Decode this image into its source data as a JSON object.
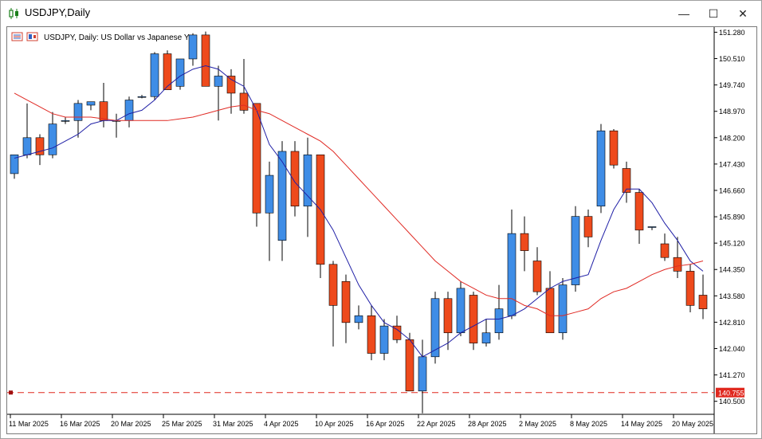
{
  "window": {
    "title": "USDJPY,Daily",
    "minimize_glyph": "—",
    "maximize_glyph": "☐",
    "close_glyph": "✕"
  },
  "chart_data": {
    "type": "candlestick",
    "title": "USDJPY, Daily:  US Dollar vs Japanese Yen",
    "symbol": "USDJPY",
    "timeframe": "Daily",
    "ylim": [
      140.12,
      151.43
    ],
    "y_ticks": [
      "151.280",
      "150.510",
      "149.740",
      "148.970",
      "148.200",
      "147.430",
      "146.660",
      "145.890",
      "145.120",
      "144.350",
      "143.580",
      "142.810",
      "142.040",
      "141.270",
      "140.500"
    ],
    "x_ticks": [
      {
        "label": "11 Mar 2025",
        "index": 0
      },
      {
        "label": "16 Mar 2025",
        "index": 4
      },
      {
        "label": "20 Mar 2025",
        "index": 8
      },
      {
        "label": "25 Mar 2025",
        "index": 12
      },
      {
        "label": "31 Mar 2025",
        "index": 16
      },
      {
        "label": "4 Apr 2025",
        "index": 20
      },
      {
        "label": "10 Apr 2025",
        "index": 24
      },
      {
        "label": "16 Apr 2025",
        "index": 28
      },
      {
        "label": "22 Apr 2025",
        "index": 32
      },
      {
        "label": "28 Apr 2025",
        "index": 36
      },
      {
        "label": "2 May 2025",
        "index": 40
      },
      {
        "label": "8 May 2025",
        "index": 44
      },
      {
        "label": "14 May 2025",
        "index": 48
      },
      {
        "label": "20 May 2025",
        "index": 52
      }
    ],
    "horizontal_line": {
      "value": 140.755,
      "label": "140.755",
      "color": "#e0281e",
      "style": "dashed"
    },
    "colors": {
      "bull": "#3f8de6",
      "bear": "#ee4a1c",
      "ma_fast": "#1f1fa6",
      "ma_slow": "#e02a24",
      "grid": "none"
    },
    "grid": false,
    "candles": [
      {
        "o": 147.15,
        "h": 147.7,
        "l": 147.0,
        "c": 147.7
      },
      {
        "o": 147.7,
        "h": 149.2,
        "l": 147.6,
        "c": 148.2
      },
      {
        "o": 148.2,
        "h": 148.3,
        "l": 147.4,
        "c": 147.7
      },
      {
        "o": 147.7,
        "h": 148.95,
        "l": 147.6,
        "c": 148.6
      },
      {
        "o": 148.7,
        "h": 148.8,
        "l": 148.6,
        "c": 148.7
      },
      {
        "o": 148.7,
        "h": 149.3,
        "l": 148.2,
        "c": 149.2
      },
      {
        "o": 149.15,
        "h": 149.25,
        "l": 149.0,
        "c": 149.25
      },
      {
        "o": 149.25,
        "h": 149.8,
        "l": 148.5,
        "c": 148.7
      },
      {
        "o": 148.7,
        "h": 148.9,
        "l": 148.2,
        "c": 148.7
      },
      {
        "o": 148.7,
        "h": 149.4,
        "l": 148.5,
        "c": 149.3
      },
      {
        "o": 149.4,
        "h": 149.45,
        "l": 149.35,
        "c": 149.4
      },
      {
        "o": 149.4,
        "h": 150.7,
        "l": 149.3,
        "c": 150.65
      },
      {
        "o": 150.65,
        "h": 150.75,
        "l": 149.6,
        "c": 149.6
      },
      {
        "o": 149.7,
        "h": 150.5,
        "l": 149.6,
        "c": 150.5
      },
      {
        "o": 150.5,
        "h": 151.25,
        "l": 150.3,
        "c": 151.2
      },
      {
        "o": 151.2,
        "h": 151.3,
        "l": 149.7,
        "c": 149.7
      },
      {
        "o": 149.7,
        "h": 150.3,
        "l": 148.7,
        "c": 150.0
      },
      {
        "o": 150.0,
        "h": 150.2,
        "l": 148.9,
        "c": 149.5
      },
      {
        "o": 149.5,
        "h": 150.5,
        "l": 148.9,
        "c": 149.0
      },
      {
        "o": 149.2,
        "h": 149.2,
        "l": 145.6,
        "c": 146.0
      },
      {
        "o": 146.0,
        "h": 147.5,
        "l": 144.6,
        "c": 147.1
      },
      {
        "o": 145.2,
        "h": 148.1,
        "l": 144.6,
        "c": 147.8
      },
      {
        "o": 147.8,
        "h": 148.1,
        "l": 145.9,
        "c": 146.2
      },
      {
        "o": 146.2,
        "h": 148.2,
        "l": 145.3,
        "c": 147.7
      },
      {
        "o": 147.7,
        "h": 147.7,
        "l": 144.1,
        "c": 144.5
      },
      {
        "o": 144.5,
        "h": 144.6,
        "l": 142.1,
        "c": 143.3
      },
      {
        "o": 144.0,
        "h": 144.2,
        "l": 142.2,
        "c": 142.8
      },
      {
        "o": 142.8,
        "h": 143.3,
        "l": 142.6,
        "c": 143.0
      },
      {
        "o": 143.0,
        "h": 143.3,
        "l": 141.7,
        "c": 141.9
      },
      {
        "o": 141.9,
        "h": 142.9,
        "l": 141.7,
        "c": 142.7
      },
      {
        "o": 142.7,
        "h": 143.0,
        "l": 142.2,
        "c": 142.3
      },
      {
        "o": 142.3,
        "h": 142.5,
        "l": 140.8,
        "c": 140.8
      },
      {
        "o": 140.8,
        "h": 142.3,
        "l": 140.15,
        "c": 141.8
      },
      {
        "o": 141.8,
        "h": 143.7,
        "l": 141.6,
        "c": 143.5
      },
      {
        "o": 143.5,
        "h": 143.7,
        "l": 142.0,
        "c": 142.5
      },
      {
        "o": 142.5,
        "h": 144.0,
        "l": 142.4,
        "c": 143.8
      },
      {
        "o": 143.6,
        "h": 143.7,
        "l": 142.0,
        "c": 142.2
      },
      {
        "o": 142.2,
        "h": 142.9,
        "l": 142.1,
        "c": 142.5
      },
      {
        "o": 142.5,
        "h": 143.9,
        "l": 142.3,
        "c": 143.2
      },
      {
        "o": 143.0,
        "h": 146.1,
        "l": 142.9,
        "c": 145.4
      },
      {
        "o": 145.4,
        "h": 145.9,
        "l": 144.3,
        "c": 144.9
      },
      {
        "o": 144.6,
        "h": 145.0,
        "l": 143.6,
        "c": 143.7
      },
      {
        "o": 143.8,
        "h": 144.3,
        "l": 142.5,
        "c": 142.5
      },
      {
        "o": 142.5,
        "h": 144.1,
        "l": 142.3,
        "c": 143.9
      },
      {
        "o": 143.9,
        "h": 146.2,
        "l": 143.7,
        "c": 145.9
      },
      {
        "o": 145.9,
        "h": 146.1,
        "l": 145.0,
        "c": 145.3
      },
      {
        "o": 146.2,
        "h": 148.6,
        "l": 146.0,
        "c": 148.4
      },
      {
        "o": 148.4,
        "h": 148.45,
        "l": 147.3,
        "c": 147.4
      },
      {
        "o": 147.3,
        "h": 147.5,
        "l": 146.3,
        "c": 146.6
      },
      {
        "o": 146.6,
        "h": 146.7,
        "l": 145.1,
        "c": 145.5
      },
      {
        "o": 145.6,
        "h": 145.6,
        "l": 145.5,
        "c": 145.6
      },
      {
        "o": 145.1,
        "h": 145.4,
        "l": 144.6,
        "c": 144.7
      },
      {
        "o": 144.7,
        "h": 145.3,
        "l": 144.1,
        "c": 144.3
      },
      {
        "o": 144.3,
        "h": 144.5,
        "l": 143.1,
        "c": 143.3
      },
      {
        "o": 143.6,
        "h": 144.2,
        "l": 142.9,
        "c": 143.2
      }
    ],
    "series": [
      {
        "values": [
          147.6,
          147.7,
          147.8,
          147.9,
          148.1,
          148.3,
          148.6,
          148.7,
          148.7,
          148.9,
          149.0,
          149.3,
          149.7,
          150.0,
          150.2,
          150.3,
          150.2,
          149.9,
          149.7,
          149.0,
          148.0,
          147.5,
          146.9,
          146.5,
          146.1,
          145.5,
          144.7,
          143.9,
          143.3,
          142.8,
          142.6,
          142.3,
          141.8,
          142.0,
          142.2,
          142.5,
          142.7,
          142.9,
          142.9,
          143.0,
          143.2,
          143.5,
          143.8,
          144.0,
          144.1,
          144.2,
          145.2,
          146.1,
          146.7,
          146.7,
          146.3,
          145.7,
          145.2,
          144.6,
          144.3
        ]
      },
      {
        "values": [
          149.5,
          149.3,
          149.1,
          148.9,
          148.8,
          148.8,
          148.8,
          148.75,
          148.7,
          148.7,
          148.7,
          148.7,
          148.7,
          148.75,
          148.8,
          148.9,
          149.0,
          149.1,
          149.15,
          149.0,
          148.9,
          148.7,
          148.5,
          148.3,
          148.1,
          147.8,
          147.4,
          147.0,
          146.6,
          146.2,
          145.8,
          145.4,
          145.0,
          144.6,
          144.3,
          144.0,
          143.8,
          143.6,
          143.5,
          143.5,
          143.3,
          143.2,
          143.0,
          143.0,
          143.1,
          143.2,
          143.5,
          143.7,
          143.8,
          144.0,
          144.2,
          144.35,
          144.45,
          144.5,
          144.6
        ]
      }
    ]
  }
}
